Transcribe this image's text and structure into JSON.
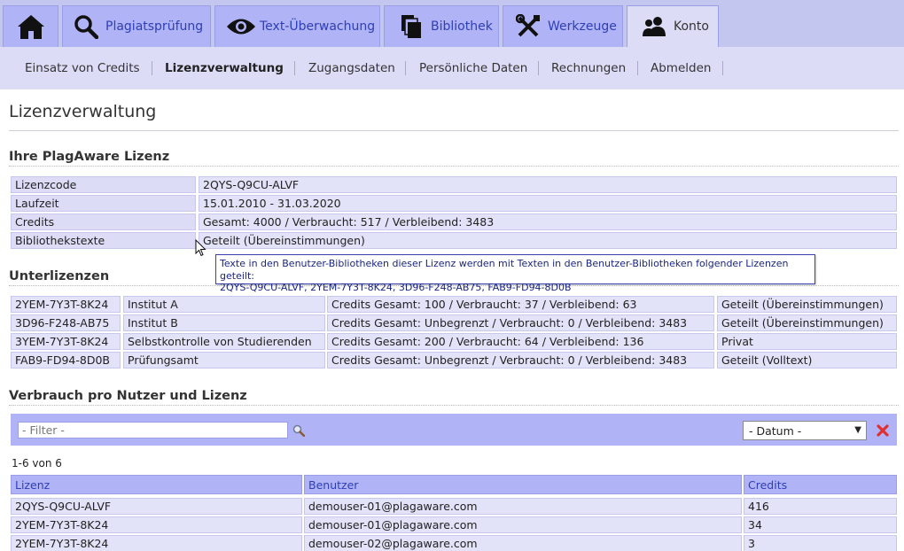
{
  "nav": {
    "tabs": [
      {
        "label": ""
      },
      {
        "label": "Plagiatsprüfung"
      },
      {
        "label": "Text-Überwachung"
      },
      {
        "label": "Bibliothek"
      },
      {
        "label": "Werkzeuge"
      },
      {
        "label": "Konto"
      }
    ]
  },
  "subnav": {
    "items": [
      {
        "label": "Einsatz von Credits"
      },
      {
        "label": "Lizenzverwaltung"
      },
      {
        "label": "Zugangsdaten"
      },
      {
        "label": "Persönliche Daten"
      },
      {
        "label": "Rechnungen"
      },
      {
        "label": "Abmelden"
      }
    ]
  },
  "page": {
    "title": "Lizenzverwaltung"
  },
  "license": {
    "title": "Ihre PlagAware Lizenz",
    "rows": [
      {
        "label": "Lizenzcode",
        "value": "2QYS-Q9CU-ALVF"
      },
      {
        "label": "Laufzeit",
        "value": "15.01.2010 - 31.03.2020"
      },
      {
        "label": "Credits",
        "value": "Gesamt: 4000 / Verbraucht: 517 / Verbleibend: 3483"
      },
      {
        "label": "Bibliothekstexte",
        "value": "Geteilt (Übereinstimmungen)"
      }
    ]
  },
  "tooltip": {
    "line1": "Texte in den Benutzer-Bibliotheken dieser Lizenz werden mit Texten in den Benutzer-Bibliotheken folgender Lizenzen geteilt:",
    "line2": "2QYS-Q9CU-ALVF, 2YEM-7Y3T-8K24, 3D96-F248-AB75, FAB9-FD94-8D0B"
  },
  "sublicenses": {
    "title": "Unterlizenzen",
    "rows": [
      {
        "code": "2YEM-7Y3T-8K24",
        "name": "Institut A",
        "credits": "Credits Gesamt: 100 / Verbraucht: 37 / Verbleibend: 63",
        "sharing": "Geteilt (Übereinstimmungen)"
      },
      {
        "code": "3D96-F248-AB75",
        "name": "Institut B",
        "credits": "Credits Gesamt: Unbegrenzt / Verbraucht: 0 / Verbleibend: 3483",
        "sharing": "Geteilt (Übereinstimmungen)"
      },
      {
        "code": "3YEM-7Y3T-8K24",
        "name": "Selbstkontrolle von Studierenden",
        "credits": "Credits Gesamt: 200 / Verbraucht: 64 / Verbleibend: 136",
        "sharing": "Privat"
      },
      {
        "code": "FAB9-FD94-8D0B",
        "name": "Prüfungsamt",
        "credits": "Credits Gesamt: Unbegrenzt / Verbraucht: 0 / Verbleibend: 3483",
        "sharing": "Geteilt (Volltext)"
      }
    ]
  },
  "usage": {
    "title": "Verbrauch pro Nutzer und Lizenz",
    "filter_placeholder": "- Filter -",
    "date_select": "- Datum -",
    "count": "1-6 von 6",
    "headers": {
      "license": "Lizenz",
      "user": "Benutzer",
      "credits": "Credits"
    },
    "rows": [
      {
        "license": "2QYS-Q9CU-ALVF",
        "user": "demouser-01@plagaware.com",
        "credits": "416"
      },
      {
        "license": "2YEM-7Y3T-8K24",
        "user": "demouser-01@plagaware.com",
        "credits": "34"
      },
      {
        "license": "2YEM-7Y3T-8K24",
        "user": "demouser-02@plagaware.com",
        "credits": "3"
      }
    ]
  },
  "colors": {
    "accent": "#2f3fb5",
    "tab_bg": "#b0b3f5",
    "light_bg": "#dcdcf7",
    "clear": "#e03030"
  }
}
